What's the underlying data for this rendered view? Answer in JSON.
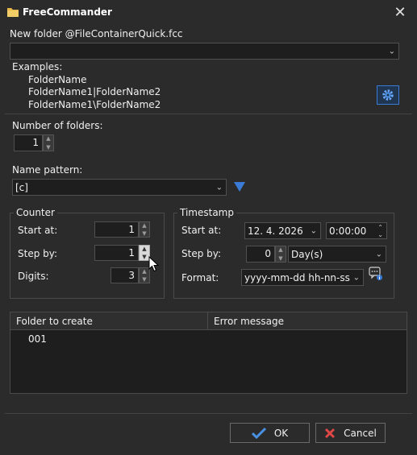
{
  "window": {
    "title": "FreeCommander",
    "close_glyph": "✕"
  },
  "new_folder": {
    "label": "New folder @FileContainerQuick.fcc",
    "value": "",
    "examples_label": "Examples:",
    "examples": [
      "FolderName",
      "FolderName1|FolderName2",
      "FolderName1\\FolderName2"
    ],
    "settings_icon": "gear-icon"
  },
  "number_of_folders": {
    "label": "Number of folders:",
    "value": "1"
  },
  "name_pattern": {
    "label": "Name pattern:",
    "value": "[c]",
    "menu_icon": "triangle-down-icon"
  },
  "counter": {
    "title": "Counter",
    "start_label": "Start at:",
    "start_value": "1",
    "step_label": "Step by:",
    "step_value": "1",
    "digits_label": "Digits:",
    "digits_value": "3"
  },
  "timestamp": {
    "title": "Timestamp",
    "start_label": "Start at:",
    "date_value": "12. 4. 2026",
    "time_value": "0:00:00",
    "step_label": "Step by:",
    "step_value": "0",
    "step_unit": "Day(s)",
    "format_label": "Format:",
    "format_value": "yyyy-mm-dd hh-nn-ss",
    "info_icon": "format-info-icon"
  },
  "table": {
    "columns": [
      "Folder to create",
      "Error message"
    ],
    "rows": [
      [
        "001",
        ""
      ]
    ]
  },
  "buttons": {
    "ok": "OK",
    "cancel": "Cancel"
  },
  "colors": {
    "background": "#2b2b2b",
    "input_bg": "#1e1e1e",
    "accent_blue": "#3a7bd5",
    "ok_check": "#4a90e2",
    "cancel_x": "#e04848"
  }
}
